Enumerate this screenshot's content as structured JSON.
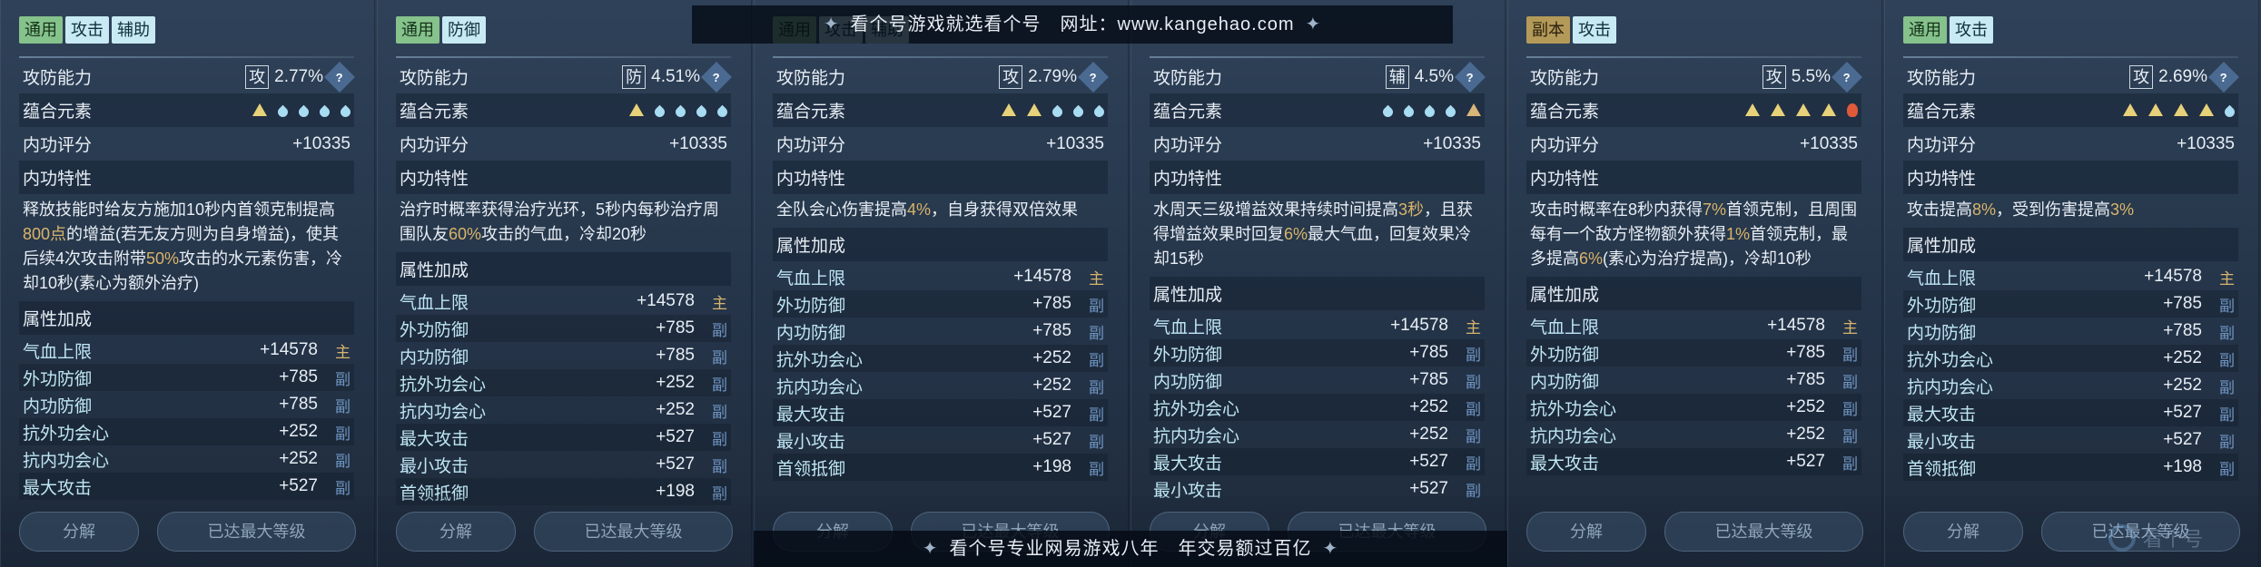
{
  "watermark_top": {
    "text": "看个号游戏就选看个号　网址：www.kangehao.com"
  },
  "watermark_bottom": {
    "text": "看个号专业网易游戏八年　年交易额过百亿"
  },
  "corner_logo": {
    "text": "看个号"
  },
  "labels": {
    "attack_defense": "攻防能力",
    "elements": "蕴合元素",
    "score": "内功评分",
    "trait": "内功特性",
    "attr_bonus": "属性加成",
    "decompose": "分解",
    "max_level": "已达最大等级",
    "help": "?"
  },
  "panels": [
    {
      "tags": [
        {
          "text": "通用",
          "style": "g"
        },
        {
          "text": "攻击",
          "style": "b"
        },
        {
          "text": "辅助",
          "style": "b"
        }
      ],
      "kind": "攻",
      "percent": "2.77%",
      "elements": [
        "tri",
        "drop",
        "drop",
        "drop",
        "drop"
      ],
      "score": "+10335",
      "desc": [
        {
          "t": "释放技能时给友方施加10秒内首领克制提高"
        },
        {
          "t": "800点",
          "h": 1
        },
        {
          "t": "的增益(若无友方则为自身增益)，使其后续4次攻击附带"
        },
        {
          "t": "50%",
          "h": 1
        },
        {
          "t": "攻击的水元素伤害，冷却10秒(素心为额外治疗)"
        }
      ],
      "attrs": [
        {
          "name": "气血上限",
          "val": "+14578",
          "mark": "主",
          "type": "main"
        },
        {
          "name": "外功防御",
          "val": "+785",
          "mark": "副",
          "type": "sub"
        },
        {
          "name": "内功防御",
          "val": "+785",
          "mark": "副",
          "type": "sub"
        },
        {
          "name": "抗外功会心",
          "val": "+252",
          "mark": "副",
          "type": "sub"
        },
        {
          "name": "抗内功会心",
          "val": "+252",
          "mark": "副",
          "type": "sub"
        },
        {
          "name": "最大攻击",
          "val": "+527",
          "mark": "副",
          "type": "sub"
        }
      ]
    },
    {
      "tags": [
        {
          "text": "通用",
          "style": "g"
        },
        {
          "text": "防御",
          "style": "b"
        }
      ],
      "kind": "防",
      "percent": "4.51%",
      "elements": [
        "tri",
        "drop",
        "drop",
        "drop",
        "drop"
      ],
      "score": "+10335",
      "desc": [
        {
          "t": "治疗时概率获得治疗光环，5秒内每秒治疗周围队友"
        },
        {
          "t": "60%",
          "h": 1
        },
        {
          "t": "攻击的气血，冷却20秒"
        }
      ],
      "attrs": [
        {
          "name": "气血上限",
          "val": "+14578",
          "mark": "主",
          "type": "main"
        },
        {
          "name": "外功防御",
          "val": "+785",
          "mark": "副",
          "type": "sub"
        },
        {
          "name": "内功防御",
          "val": "+785",
          "mark": "副",
          "type": "sub"
        },
        {
          "name": "抗外功会心",
          "val": "+252",
          "mark": "副",
          "type": "sub"
        },
        {
          "name": "抗内功会心",
          "val": "+252",
          "mark": "副",
          "type": "sub"
        },
        {
          "name": "最大攻击",
          "val": "+527",
          "mark": "副",
          "type": "sub"
        },
        {
          "name": "最小攻击",
          "val": "+527",
          "mark": "副",
          "type": "sub"
        },
        {
          "name": "首领抵御",
          "val": "+198",
          "mark": "副",
          "type": "sub"
        }
      ]
    },
    {
      "tags": [
        {
          "text": "通用",
          "style": "g"
        },
        {
          "text": "攻击",
          "style": "b"
        },
        {
          "text": "辅助",
          "style": "b"
        }
      ],
      "kind": "攻",
      "percent": "2.79%",
      "elements": [
        "tri",
        "tri",
        "drop",
        "drop",
        "drop"
      ],
      "score": "+10335",
      "desc": [
        {
          "t": "全队会心伤害提高"
        },
        {
          "t": "4%",
          "h": 1
        },
        {
          "t": "，自身获得双倍效果"
        }
      ],
      "attrs": [
        {
          "name": "气血上限",
          "val": "+14578",
          "mark": "主",
          "type": "main"
        },
        {
          "name": "外功防御",
          "val": "+785",
          "mark": "副",
          "type": "sub"
        },
        {
          "name": "内功防御",
          "val": "+785",
          "mark": "副",
          "type": "sub"
        },
        {
          "name": "抗外功会心",
          "val": "+252",
          "mark": "副",
          "type": "sub"
        },
        {
          "name": "抗内功会心",
          "val": "+252",
          "mark": "副",
          "type": "sub"
        },
        {
          "name": "最大攻击",
          "val": "+527",
          "mark": "副",
          "type": "sub"
        },
        {
          "name": "最小攻击",
          "val": "+527",
          "mark": "副",
          "type": "sub"
        },
        {
          "name": "首领抵御",
          "val": "+198",
          "mark": "副",
          "type": "sub"
        }
      ]
    },
    {
      "tags": [],
      "kind": "辅",
      "percent": "4.5%",
      "elements": [
        "drop",
        "drop",
        "drop",
        "drop",
        "mt"
      ],
      "score": "+10335",
      "desc": [
        {
          "t": "水周天三级增益效果持续时间提高"
        },
        {
          "t": "3秒",
          "h": 1
        },
        {
          "t": "，且获得增益效果时回复"
        },
        {
          "t": "6%",
          "h": 1
        },
        {
          "t": "最大气血，回复效果冷却15秒"
        }
      ],
      "attrs": [
        {
          "name": "气血上限",
          "val": "+14578",
          "mark": "主",
          "type": "main"
        },
        {
          "name": "外功防御",
          "val": "+785",
          "mark": "副",
          "type": "sub"
        },
        {
          "name": "内功防御",
          "val": "+785",
          "mark": "副",
          "type": "sub"
        },
        {
          "name": "抗外功会心",
          "val": "+252",
          "mark": "副",
          "type": "sub"
        },
        {
          "name": "抗内功会心",
          "val": "+252",
          "mark": "副",
          "type": "sub"
        },
        {
          "name": "最大攻击",
          "val": "+527",
          "mark": "副",
          "type": "sub"
        },
        {
          "name": "最小攻击",
          "val": "+527",
          "mark": "副",
          "type": "sub"
        }
      ]
    },
    {
      "tags": [
        {
          "text": "副本",
          "style": "y"
        },
        {
          "text": "攻击",
          "style": "b"
        }
      ],
      "kind": "攻",
      "percent": "5.5%",
      "elements": [
        "tri",
        "tri",
        "tri",
        "tri",
        "flame"
      ],
      "score": "+10335",
      "desc": [
        {
          "t": "攻击时概率在8秒内获得"
        },
        {
          "t": "7%",
          "h": 1
        },
        {
          "t": "首领克制，且周围每有一个敌方怪物额外获得"
        },
        {
          "t": "1%",
          "h": 1
        },
        {
          "t": "首领克制，最多提高"
        },
        {
          "t": "6%",
          "h": 1
        },
        {
          "t": "(素心为治疗提高)，冷却10秒"
        }
      ],
      "attrs": [
        {
          "name": "气血上限",
          "val": "+14578",
          "mark": "主",
          "type": "main"
        },
        {
          "name": "外功防御",
          "val": "+785",
          "mark": "副",
          "type": "sub"
        },
        {
          "name": "内功防御",
          "val": "+785",
          "mark": "副",
          "type": "sub"
        },
        {
          "name": "抗外功会心",
          "val": "+252",
          "mark": "副",
          "type": "sub"
        },
        {
          "name": "抗内功会心",
          "val": "+252",
          "mark": "副",
          "type": "sub"
        },
        {
          "name": "最大攻击",
          "val": "+527",
          "mark": "副",
          "type": "sub"
        }
      ]
    },
    {
      "tags": [
        {
          "text": "通用",
          "style": "g"
        },
        {
          "text": "攻击",
          "style": "b"
        }
      ],
      "kind": "攻",
      "percent": "2.69%",
      "elements": [
        "tri",
        "tri",
        "tri",
        "tri",
        "drop"
      ],
      "score": "+10335",
      "desc": [
        {
          "t": "攻击提高"
        },
        {
          "t": "8%",
          "h": 1
        },
        {
          "t": "，受到伤害提高"
        },
        {
          "t": "3%",
          "h": 1
        }
      ],
      "attrs": [
        {
          "name": "气血上限",
          "val": "+14578",
          "mark": "主",
          "type": "main"
        },
        {
          "name": "外功防御",
          "val": "+785",
          "mark": "副",
          "type": "sub"
        },
        {
          "name": "内功防御",
          "val": "+785",
          "mark": "副",
          "type": "sub"
        },
        {
          "name": "抗外功会心",
          "val": "+252",
          "mark": "副",
          "type": "sub"
        },
        {
          "name": "抗内功会心",
          "val": "+252",
          "mark": "副",
          "type": "sub"
        },
        {
          "name": "最大攻击",
          "val": "+527",
          "mark": "副",
          "type": "sub"
        },
        {
          "name": "最小攻击",
          "val": "+527",
          "mark": "副",
          "type": "sub"
        },
        {
          "name": "首领抵御",
          "val": "+198",
          "mark": "副",
          "type": "sub"
        }
      ]
    }
  ]
}
